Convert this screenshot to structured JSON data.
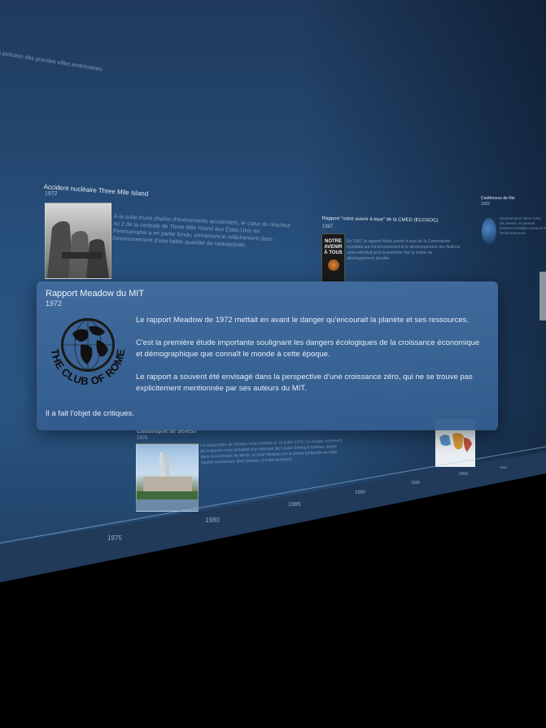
{
  "background_text": {
    "top_fragment": "r la pollution des grandes villes américaines.",
    "event1_body": "À la suite d'une chaîne d'événements accidentels, le cœur du réacteur no 2 de la centrale de Three Mile Island aux États-Unis en Pennsylvanie a en partie fondu, entraînant le relâchement dans l'environnement d'une faible quantité de radioactivité.",
    "event2_body": "En 1987, le rapport Notre avenir à tous de la Commission mondiale sur l'environnement et le développement des Nations unies introduit pour la première fois la notion de développement durable.",
    "event3_title": "Catastrophe de Seveso",
    "event3_body": "La catastrophe de Seveso s'est produite le 10 juillet 1976. Un nuage contenant de la dioxine s'est échappé d'un réacteur de l'usine chimique Icmesa, située dans la commune de Meda, et s'est répandu sur la plaine lombarde en Italie. Quatre communes, dont Seveso, ont été touchées.",
    "right_fragment": "Sommet de la Terre à Rio de Janeiro, le premier sommet mondial consacré à l'environnement."
  },
  "events": [
    {
      "title": "Accident nucléaire Three Mile Island",
      "year": "1972"
    },
    {
      "title": "Rapport \"notre avenir à tous\" de la CMED (ECOSOC)",
      "year": "1987"
    },
    {
      "title": "Conférence de Rio",
      "year": "1992"
    },
    {
      "title": "Catastrophe de Seveso",
      "year": "1976"
    }
  ],
  "book_cover": {
    "line1": "NOTRE",
    "line2": "AVENIR",
    "line3": "À TOUS"
  },
  "axis_ticks": [
    "1975",
    "1980",
    "1985",
    "1990",
    "1995",
    "2000",
    "2005"
  ],
  "card": {
    "title": "Rapport Meadow du MIT",
    "year": "1972",
    "paragraphs": [
      "Le rapport Meadow de 1972 mettait en avant le danger qu'encourait la planète et ses ressources.",
      "C'est la première étude importante soulignant les dangers écologiques de la croissance économique et démographique que connaît le monde à cette époque.",
      "Le rapport a souvent été envisagé dans la perspective d'une croissance zéro, qui ne se trouve pas explicitement mentionnée par ses auteurs du MIT."
    ],
    "footer": "Il a fait l'objet de critiques.",
    "logo_text": "THE CLUB OF ROME"
  },
  "colors": {
    "wall": "#27507d",
    "card": "#3f6a9e",
    "text": "#e4ecf7"
  }
}
